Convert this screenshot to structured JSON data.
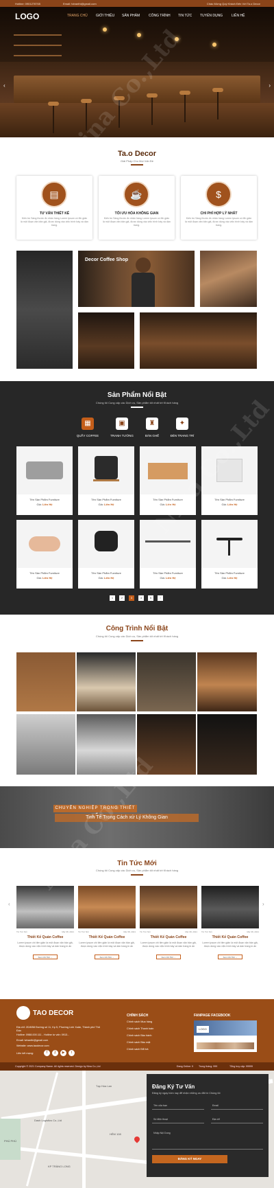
{
  "topbar": {
    "hotline": "Hotline: 0901278765",
    "email": "Email: tvtranthi@gmail.com",
    "welcome": "Chào Mừng Quý Khách Đến Với Ta.o Decor"
  },
  "nav": {
    "logo": "LOGO",
    "items": [
      "TRANG CHỦ",
      "GIỚI THIỆU",
      "SẢN PHẨM",
      "CÔNG TRÌNH",
      "TIN TỨC",
      "TUYỂN DỤNG",
      "LIÊN HỆ"
    ]
  },
  "intro": {
    "title": "Ta.o Decor",
    "subtitle": "Giải Pháp Cho Mọi Vấn Đề",
    "cards": [
      {
        "icon": "checklist-icon",
        "glyph": "▤",
        "title": "TƯ VẤN THIẾT KẾ",
        "text": "Kiến trú Sáng thước đc nhân hàng Lorem Ipsum có lẽn giản là một đoạn văn bản giả, được dùng vào việc trình bày và dàn trang."
      },
      {
        "icon": "coffee-cup-icon",
        "glyph": "☕",
        "title": "TỐI ƯU HÓA KHÔNG GIAN",
        "text": "Kiến trú Sáng thước đc nhân hàng Lorem Ipsum có lẽn giản là một đoạn văn bản giả, được dùng vào việc trình bày và dàn trang."
      },
      {
        "icon": "dollar-icon",
        "glyph": "$",
        "title": "CHI PHÍ HỢP LÝ NHẤT",
        "text": "Kiến trú Sáng thước đc nhân hàng Lorem Ipsum có lẽn giản là một đoạn văn bản giả, được dùng vào việc trình bày và dàn trang."
      }
    ]
  },
  "gallery": {
    "caption": "Decor Coffee Shop"
  },
  "products": {
    "title": "Sản Phẩm Nổi Bật",
    "subtitle": "Chúng tôi Cung cấp các Dịch vụ, Sản phẩm tốt nhất tới Khách hàng",
    "tabs": [
      {
        "label": "QUẦY COFFEE",
        "icon": "counter-icon",
        "glyph": "▦"
      },
      {
        "label": "TRANH TƯỜNG",
        "icon": "frame-icon",
        "glyph": "▣"
      },
      {
        "label": "BÀN GHẾ",
        "icon": "chair-icon",
        "glyph": "♜"
      },
      {
        "label": "ĐÈN TRANG TRÍ",
        "icon": "lamp-icon",
        "glyph": "✦"
      }
    ],
    "name": "Tên Sản Phẩm Furniture",
    "price_label": "Giá:",
    "price_value": "Liên Hệ",
    "pages": [
      "1",
      "2",
      "3",
      "4",
      "5",
      "›"
    ]
  },
  "projects": {
    "title": "Công Trình Nổi Bật",
    "subtitle": "Chúng tôi Cung cấp các Dịch vụ, Sản phẩm tốt nhất tới Khách hàng"
  },
  "banner": {
    "line1": "CHUYÊN NGHIỆP TRONG THIẾT KẾ",
    "line2": "Tinh Tế Trong Cách xử Lý Không Gian"
  },
  "news": {
    "title": "Tin Tức Mới",
    "subtitle": "Chúng tôi Cung cấp các Dịch vụ, Sản phẩm tốt nhất tới Khách hàng",
    "items": [
      {
        "cat": "Tin Tức Nổi",
        "date": "Mar 08, 2021",
        "title": "Thiết Kế Quán Coffee",
        "text": "Lorem ipsum chi tiền giản là một đoạn văn bản giả, được dùng vào việc trình bày và dàn trang in ấn",
        "more": "Xem Chi Tiết →"
      },
      {
        "cat": "Tin Tức Nổi",
        "date": "Mar 08, 2021",
        "title": "Thiết Kế Quán Coffee",
        "text": "Lorem ipsum chi tiền giản là một đoạn văn bản giả, được dùng vào việc trình bày và dàn trang in ấn",
        "more": "Xem Chi Tiết →"
      },
      {
        "cat": "Tin Tức Nổi",
        "date": "Mar 08, 2021",
        "title": "Thiết Kế Quán Coffee",
        "text": "Lorem ipsum chi tiền giản là một đoạn văn bản giả, được dùng vào việc trình bày và dàn trang in ấn",
        "more": "Xem Chi Tiết →"
      },
      {
        "cat": "Tin Tức Nổi",
        "date": "Mar 08, 2021",
        "title": "Thiết Kế Quán Coffee",
        "text": "Lorem ipsum chi tiền giản là một đoạn văn bản giả, được dùng vào việc trình bày và dàn trang in ấn",
        "more": "Xem Chi Tiết →"
      }
    ]
  },
  "footer": {
    "brand": "TAO DECOR",
    "address": "Địa chỉ: 2D/8/58 Đường số 11, Kp 5, Phường Linh Xuân, Thành phố Thủ Đức",
    "phone": "Hotline: 0988.000.111 - Hotline tư vấn: 0913...",
    "email": "Email: tvtranthi@gmail.com",
    "website": "Website: www.taodecor.com",
    "social_label": "Liên kết mạng:",
    "policy_title": "CHÍNH SÁCH",
    "policies": [
      "Chính sách Mua hàng",
      "Chính sách Thanh toán",
      "Chính sách Bảo hành",
      "Chính sách Bảo mật",
      "Chính sách Đổi trả"
    ],
    "fanpage_title": "FANPAGE FACEBOOK",
    "fanpage_logo": "LOGO"
  },
  "copyright": {
    "text": "Copyright © 2021 Company Name. All rights reserved. Design by Nina Co.,Ltd",
    "online": "Đang Online: 9",
    "month": "Trong tháng: 999",
    "total": "Tổng truy cập: 99999"
  },
  "map": {
    "labels": [
      "Tạp Hóa Lan",
      "Dash Logistics Co.,Ltd",
      "HẺM 108",
      "KP TRÀNG LONG",
      "PHÚ PHÚ"
    ]
  },
  "consult": {
    "title": "Đăng Ký Tư Vấn",
    "subtitle": "Đăng ký ngay hôm nay để nhận những ưu đãi từ Chúng tôi",
    "fullname": "Tên của bạn",
    "email": "Email",
    "phone": "Số điện thoại",
    "address": "Địa chỉ",
    "note": "Nhập Nội Dung",
    "button": "ĐĂNG KÝ NGAY"
  }
}
